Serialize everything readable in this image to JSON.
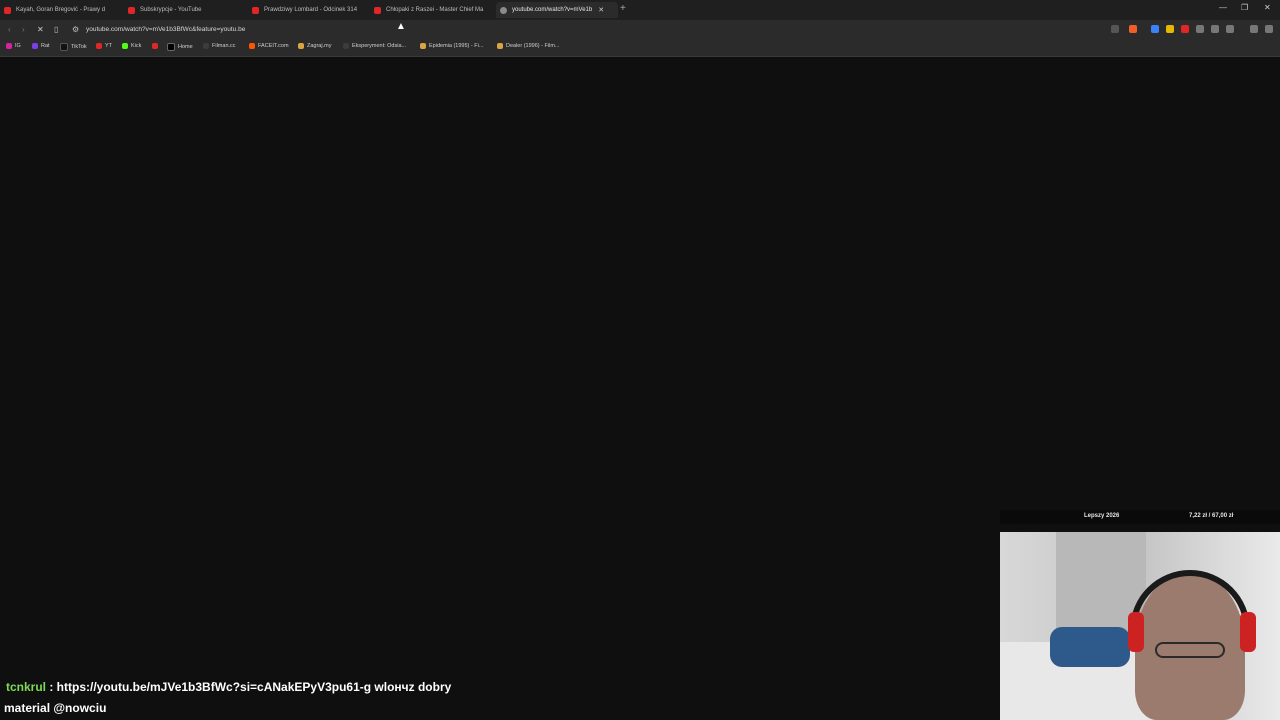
{
  "browser": {
    "tabs": [
      {
        "title": "Kayah, Goran Bregović - Prawy d",
        "favicon": "youtube-icon"
      },
      {
        "title": "Subskrypcje - YouTube",
        "favicon": "youtube-icon"
      },
      {
        "title": "Prawdziwy Lombard - Odcinek 314",
        "favicon": "youtube-icon"
      },
      {
        "title": "Chłopaki z Raszei - Master Chief Ma",
        "favicon": "youtube-icon"
      },
      {
        "title": "youtube.com/watch?v=mVe1b",
        "favicon": "loading-icon",
        "active": true
      }
    ],
    "url": "youtube.com/watch?v=mVe1b3BfWc&feature=youtu.be",
    "bookmarks": [
      {
        "label": "IG",
        "icon_color": "#d6249f"
      },
      {
        "label": "Rat",
        "icon_color": "#7b3fe4"
      },
      {
        "label": "TikTok",
        "icon_color": "#111111"
      },
      {
        "label": "YT",
        "icon_color": "#e02626"
      },
      {
        "label": "Kick",
        "icon_color": "#53fc18"
      },
      {
        "label": "",
        "icon_color": "#e02626"
      },
      {
        "label": "Home",
        "icon_color": "#000000"
      },
      {
        "label": "Filman.cc",
        "icon_color": "#3c3c3c"
      },
      {
        "label": "FACEIT.com",
        "icon_color": "#ff5500"
      },
      {
        "label": "Zagraj.my",
        "icon_color": "#d9a441"
      },
      {
        "label": "Eksperyment: Odsia...",
        "icon_color": "#3c3c3c"
      },
      {
        "label": "Epidemia (1995) - Fi...",
        "icon_color": "#d9a441"
      },
      {
        "label": "Dealer (1996) - Film...",
        "icon_color": "#d9a441"
      }
    ]
  },
  "stream_overlay": {
    "goal_label": "Lepszy 2026",
    "goal_progress": "7,22 zł / 67,00 zł"
  },
  "chat": {
    "username": "tcnkrul",
    "message": " : https://youtu.be/mJVe1b3BfWc?si=cANakEPyV3pu61-g wlончz dobry",
    "line2": "material @nowciu"
  },
  "colors": {
    "accent_red": "#e02626",
    "username_green": "#7ed957"
  }
}
